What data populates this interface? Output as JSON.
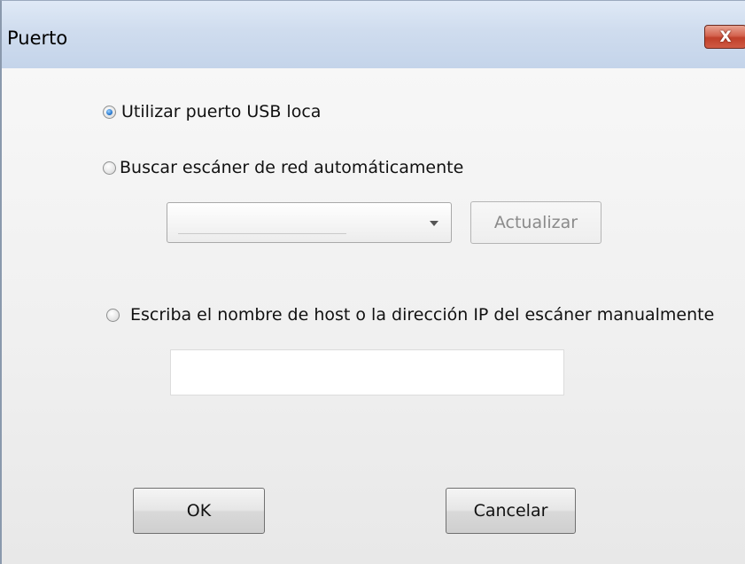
{
  "window": {
    "title": "Puerto",
    "close_label": "X"
  },
  "options": {
    "usb": {
      "label": "Utilizar puerto USB loca",
      "checked": true
    },
    "auto_network": {
      "label": "Buscar escáner de red automáticamente",
      "checked": false
    },
    "manual": {
      "label": "Escriba el nombre de host o la dirección IP del escáner manualmente",
      "checked": false
    }
  },
  "scanner_dropdown": {
    "selected": ""
  },
  "refresh_button": {
    "label": "Actualizar",
    "enabled": false
  },
  "manual_input": {
    "value": "",
    "placeholder": ""
  },
  "footer": {
    "ok_label": "OK",
    "cancel_label": "Cancelar"
  }
}
